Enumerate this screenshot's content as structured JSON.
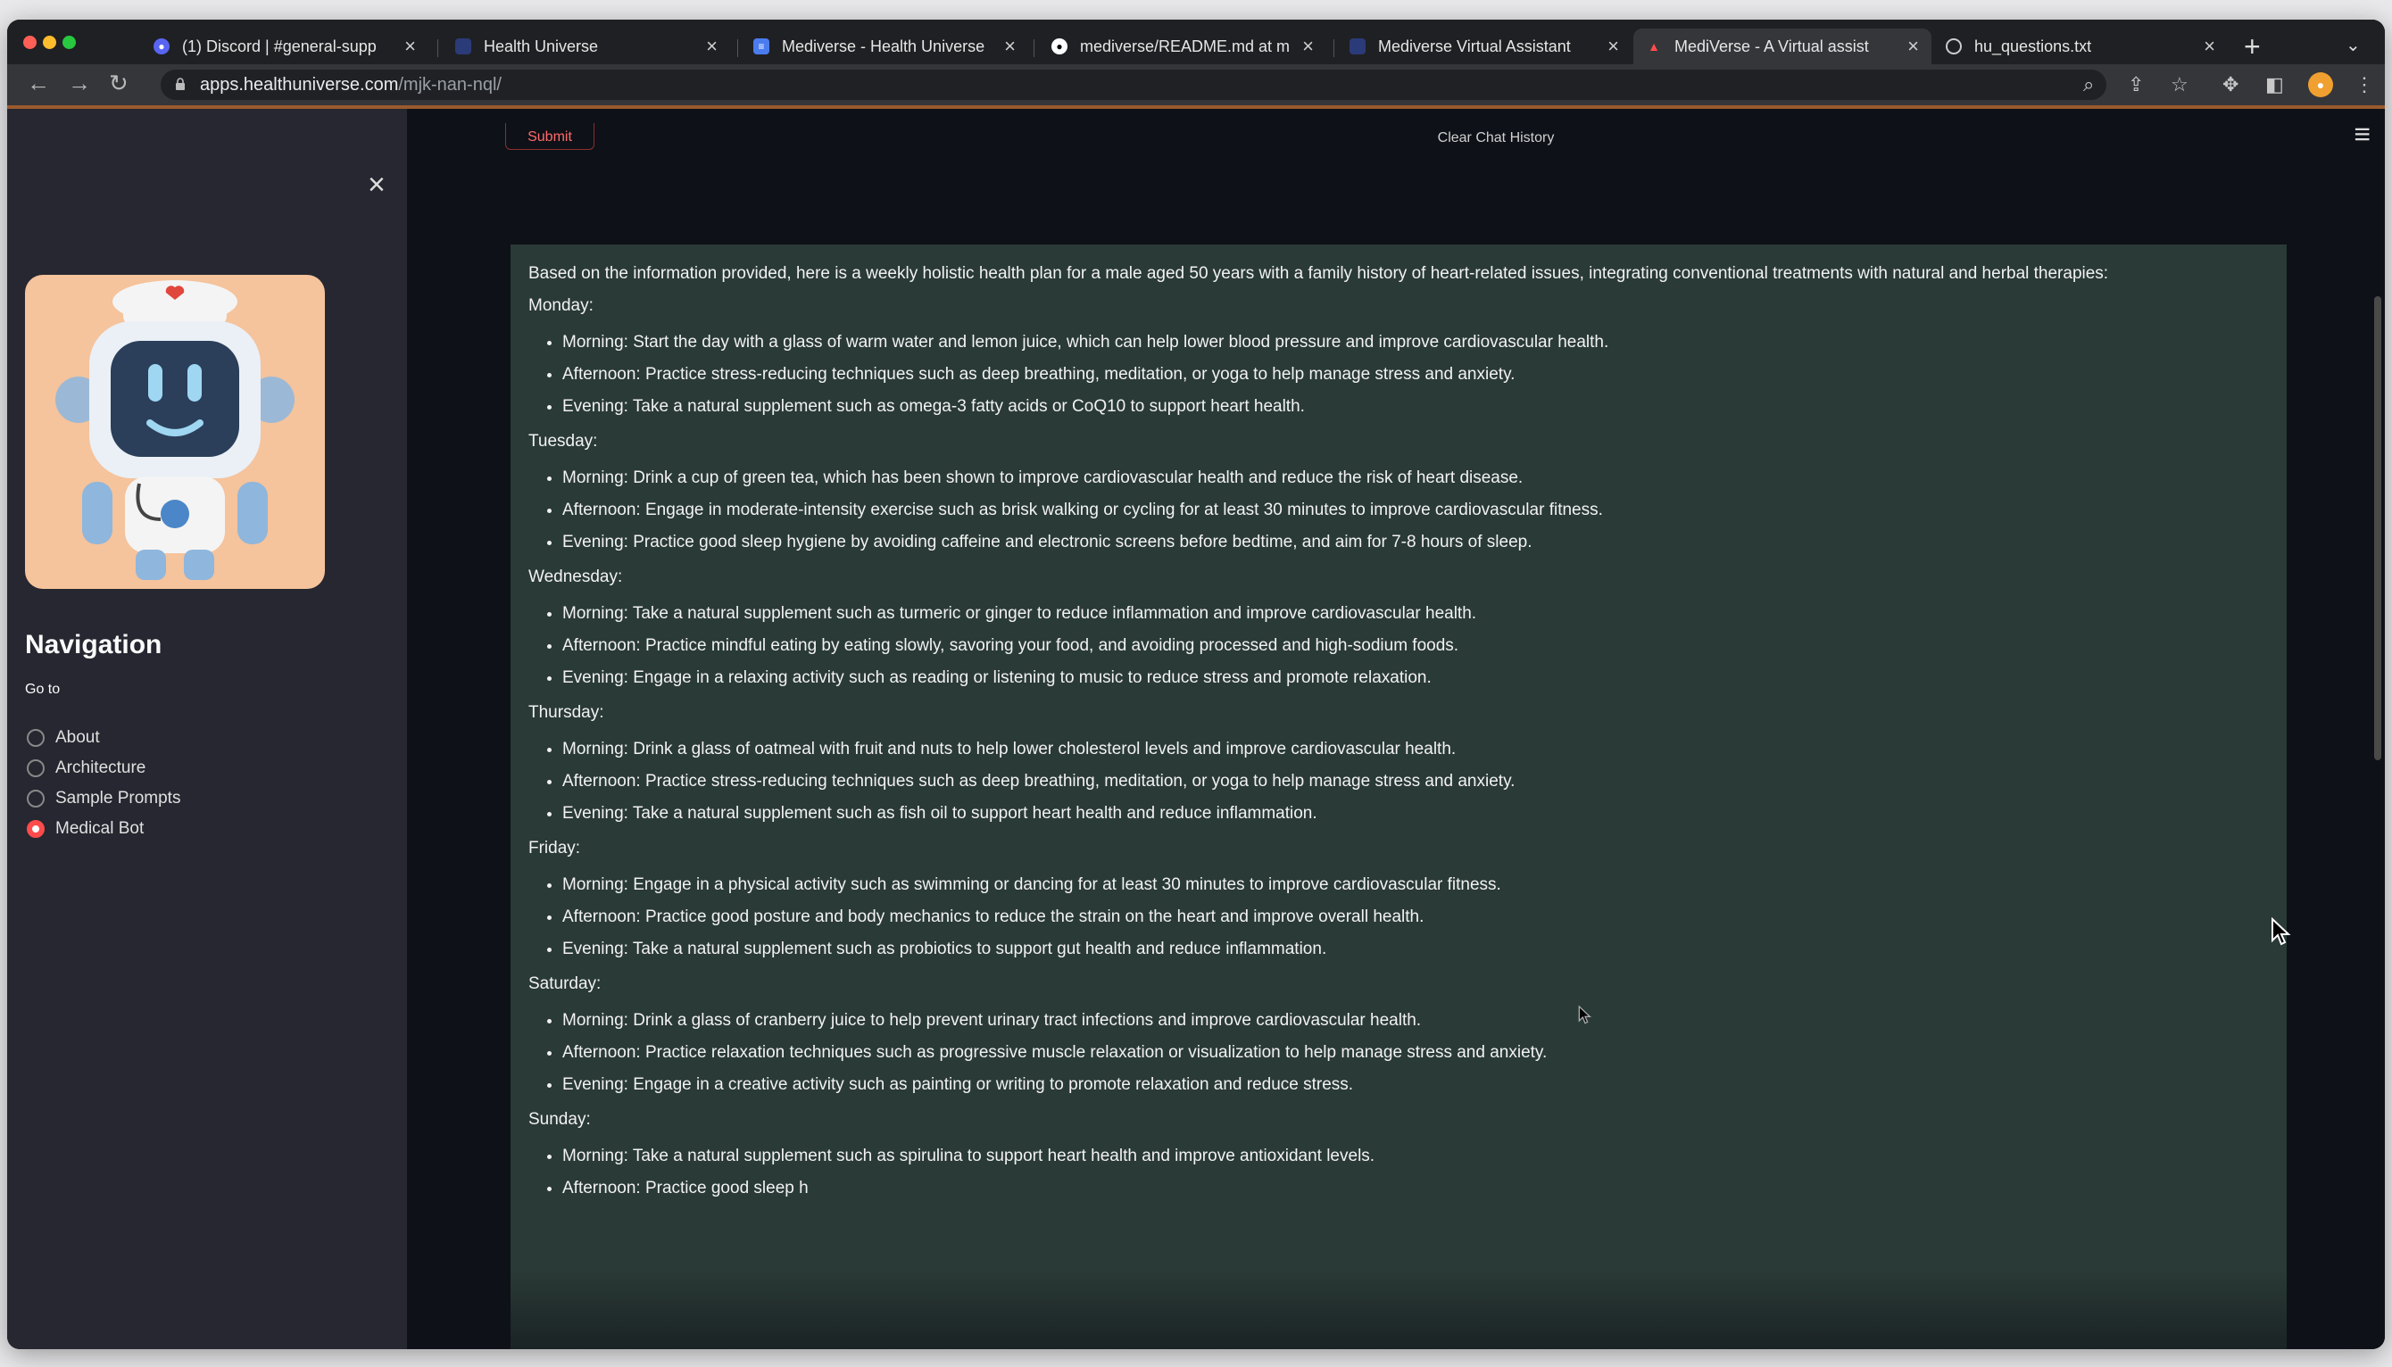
{
  "browser": {
    "tabs": [
      {
        "label": "(1) Discord | #general-supp",
        "icon": "discord-icon"
      },
      {
        "label": "Health Universe",
        "icon": "health-universe-icon"
      },
      {
        "label": "Mediverse - Health Universe",
        "icon": "document-icon"
      },
      {
        "label": "mediverse/README.md at m",
        "icon": "github-icon"
      },
      {
        "label": "Mediverse Virtual Assistant",
        "icon": "health-universe-icon"
      },
      {
        "label": "MediVerse - A Virtual assist",
        "icon": "streamlit-icon",
        "active": true
      },
      {
        "label": "hu_questions.txt",
        "icon": "globe-icon"
      }
    ],
    "url_host": "apps.healthuniverse.com",
    "url_path": "/mjk-nan-nql/"
  },
  "sidebar": {
    "title": "Navigation",
    "goto_label": "Go to",
    "options": [
      {
        "label": "About",
        "selected": false
      },
      {
        "label": "Architecture",
        "selected": false
      },
      {
        "label": "Sample Prompts",
        "selected": false
      },
      {
        "label": "Medical Bot",
        "selected": true
      }
    ]
  },
  "main": {
    "submit_label": "Submit",
    "clear_label": "Clear Chat History",
    "intro": "Based on the information provided, here is a weekly holistic health plan for a male aged 50 years with a family history of heart-related issues, integrating conventional treatments with natural and herbal therapies:",
    "days": [
      {
        "name": "Monday:",
        "items": [
          "Morning: Start the day with a glass of warm water and lemon juice, which can help lower blood pressure and improve cardiovascular health.",
          "Afternoon: Practice stress-reducing techniques such as deep breathing, meditation, or yoga to help manage stress and anxiety.",
          "Evening: Take a natural supplement such as omega-3 fatty acids or CoQ10 to support heart health."
        ]
      },
      {
        "name": "Tuesday:",
        "items": [
          "Morning: Drink a cup of green tea, which has been shown to improve cardiovascular health and reduce the risk of heart disease.",
          "Afternoon: Engage in moderate-intensity exercise such as brisk walking or cycling for at least 30 minutes to improve cardiovascular fitness.",
          "Evening: Practice good sleep hygiene by avoiding caffeine and electronic screens before bedtime, and aim for 7-8 hours of sleep."
        ]
      },
      {
        "name": "Wednesday:",
        "items": [
          "Morning: Take a natural supplement such as turmeric or ginger to reduce inflammation and improve cardiovascular health.",
          "Afternoon: Practice mindful eating by eating slowly, savoring your food, and avoiding processed and high-sodium foods.",
          "Evening: Engage in a relaxing activity such as reading or listening to music to reduce stress and promote relaxation."
        ]
      },
      {
        "name": "Thursday:",
        "items": [
          "Morning: Drink a glass of oatmeal with fruit and nuts to help lower cholesterol levels and improve cardiovascular health.",
          "Afternoon: Practice stress-reducing techniques such as deep breathing, meditation, or yoga to help manage stress and anxiety.",
          "Evening: Take a natural supplement such as fish oil to support heart health and reduce inflammation."
        ]
      },
      {
        "name": "Friday:",
        "items": [
          "Morning: Engage in a physical activity such as swimming or dancing for at least 30 minutes to improve cardiovascular fitness.",
          "Afternoon: Practice good posture and body mechanics to reduce the strain on the heart and improve overall health.",
          "Evening: Take a natural supplement such as probiotics to support gut health and reduce inflammation."
        ]
      },
      {
        "name": "Saturday:",
        "items": [
          "Morning: Drink a glass of cranberry juice to help prevent urinary tract infections and improve cardiovascular health.",
          "Afternoon: Practice relaxation techniques such as progressive muscle relaxation or visualization to help manage stress and anxiety.",
          "Evening: Engage in a creative activity such as painting or writing to promote relaxation and reduce stress."
        ]
      },
      {
        "name": "Sunday:",
        "items": [
          "Morning: Take a natural supplement such as spirulina to support heart health and improve antioxidant levels.",
          "Afternoon: Practice good sleep h"
        ]
      }
    ]
  },
  "colors": {
    "accent": "#ff4b4b",
    "answer_bg": "#2a3a36",
    "sidebar_bg": "#262730",
    "app_bg": "#0e1117"
  }
}
